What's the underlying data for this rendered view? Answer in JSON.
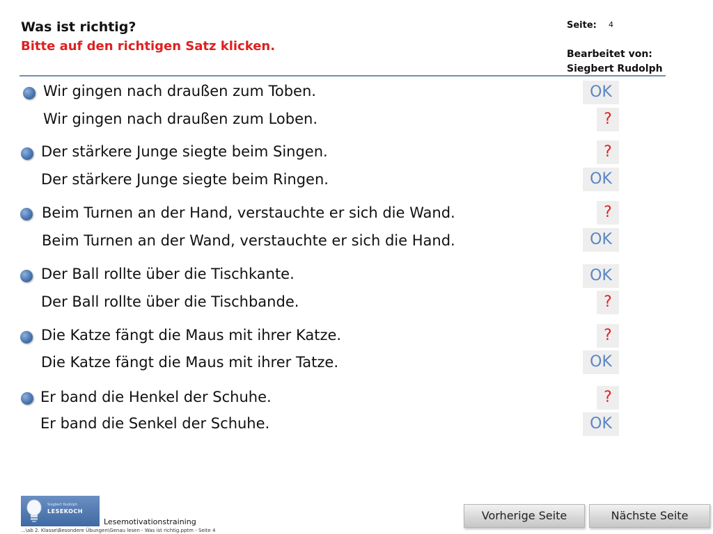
{
  "header": {
    "title": "Was ist richtig?",
    "instruction": "Bitte auf den richtigen Satz klicken.",
    "page_label": "Seite:",
    "page_number": "4",
    "editor_label": "Bearbeitet  von:",
    "editor_name": "Siegbert  Rudolph"
  },
  "questions": [
    {
      "a": {
        "text": "Wir gingen nach draußen zum Toben.",
        "feedback": "OK"
      },
      "b": {
        "text": "Wir gingen nach draußen zum Loben.",
        "feedback": "?"
      }
    },
    {
      "a": {
        "text": "Der stärkere Junge siegte beim Singen.",
        "feedback": "?"
      },
      "b": {
        "text": "Der stärkere Junge siegte beim Ringen.",
        "feedback": "OK"
      }
    },
    {
      "a": {
        "text": "Beim Turnen an der Hand, verstauchte er sich die Wand.",
        "feedback": "?"
      },
      "b": {
        "text": "Beim Turnen an der Wand, verstauchte er sich die Hand.",
        "feedback": "OK"
      }
    },
    {
      "a": {
        "text": "Der Ball rollte über die Tischkante.",
        "feedback": "OK"
      },
      "b": {
        "text": "Der Ball rollte über die Tischbande.",
        "feedback": "?"
      }
    },
    {
      "a": {
        "text": "Die Katze fängt die Maus mit ihrer Katze.",
        "feedback": "?"
      },
      "b": {
        "text": "Die Katze fängt die Maus mit ihrer Tatze.",
        "feedback": "OK"
      }
    },
    {
      "a": {
        "text": "Er band die Henkel der Schuhe.",
        "feedback": "?"
      },
      "b": {
        "text": "Er band die Senkel der Schuhe.",
        "feedback": "OK"
      }
    }
  ],
  "footer": {
    "logo_small": "Siegbert Rudolph",
    "logo_big": "LESEKOCH",
    "label": "Lesemotivationstraining",
    "path": "...\\ab 2. Klasse\\Besondere Übungen\\Genau lesen - Was ist richtig.pptm - Seite 4",
    "prev_label": "Vorherige Seite",
    "next_label": "Nächste Seite"
  },
  "colors": {
    "instruction_red": "#e02020",
    "ok_blue": "#5a86c4",
    "bullet_blue": "#4a76b0",
    "divider": "#6f8fb8"
  }
}
